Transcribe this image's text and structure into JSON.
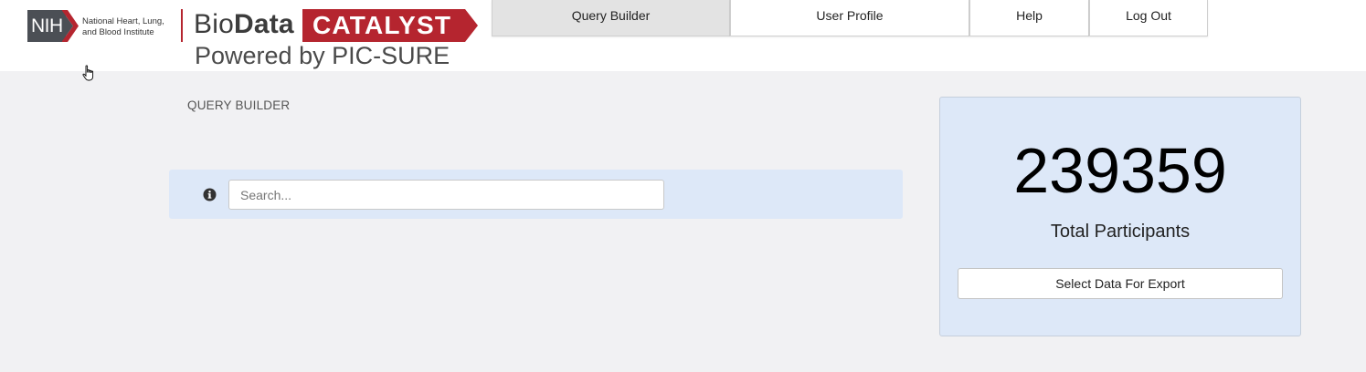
{
  "brand": {
    "nih_abbrev": "NIH",
    "institute_line1": "National Heart, Lung,",
    "institute_line2": "and Blood Institute",
    "bio": "Bio",
    "data": "Data",
    "catalyst": "CATALYST",
    "powered_by": "Powered by PIC-SURE",
    "accent_color": "#b5252f"
  },
  "nav": {
    "tabs": [
      {
        "label": "Query Builder",
        "active": true
      },
      {
        "label": "User Profile",
        "active": false
      },
      {
        "label": "Help",
        "active": false
      },
      {
        "label": "Log Out",
        "active": false
      }
    ]
  },
  "main": {
    "section_title": "QUERY BUILDER",
    "search": {
      "placeholder": "Search...",
      "value": "",
      "icon": "info-circle-icon"
    }
  },
  "stats": {
    "total_participants": "239359",
    "label": "Total Participants",
    "export_button": "Select Data For Export"
  },
  "colors": {
    "panel_bg": "#dde8f8",
    "page_bg": "#f1f1f3"
  }
}
